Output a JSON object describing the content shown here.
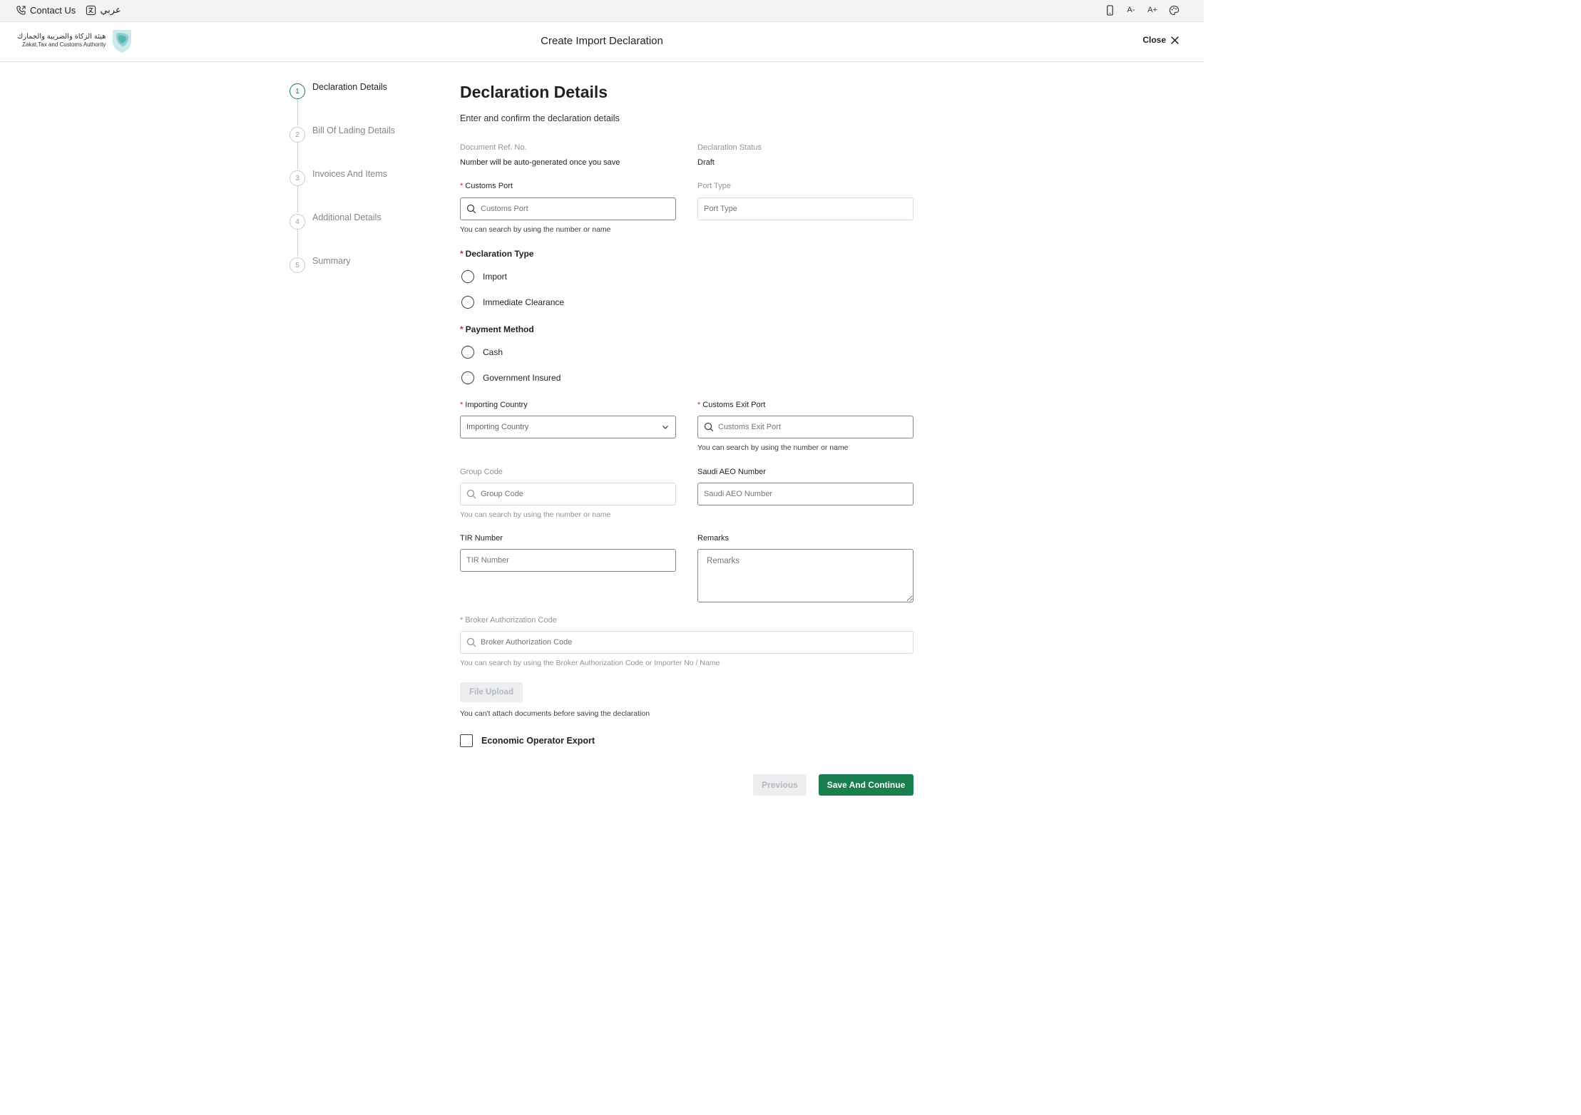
{
  "topbar": {
    "contact_label": "Contact Us",
    "language_label": "عربي",
    "icons": [
      "phone-icon",
      "translate-icon",
      "mobile-icon",
      "font-decrease-icon",
      "font-increase-icon",
      "palette-icon"
    ],
    "font_decrease_label": "A-",
    "font_increase_label": "A+"
  },
  "header": {
    "logo_ar": "هيئة الزكاة والضريبة والجمارك",
    "logo_en": "Zakat,Tax and Customs Authority",
    "title": "Create Import Declaration",
    "close_label": "Close"
  },
  "stepper": {
    "steps": [
      {
        "number": "1",
        "label": "Declaration Details",
        "active": true
      },
      {
        "number": "2",
        "label": "Bill Of Lading Details",
        "active": false
      },
      {
        "number": "3",
        "label": "Invoices And Items",
        "active": false
      },
      {
        "number": "4",
        "label": "Additional Details",
        "active": false
      },
      {
        "number": "5",
        "label": "Summary",
        "active": false
      }
    ]
  },
  "form": {
    "title": "Declaration Details",
    "subtitle": "Enter and confirm the declaration details",
    "doc_ref_label": "Document Ref. No.",
    "doc_ref_value": "Number will be auto-generated once you save",
    "status_label": "Declaration Status",
    "status_value": "Draft",
    "customs_port_label": "Customs Port",
    "customs_port_placeholder": "Customs Port",
    "customs_port_hint": "You can search by using the number or name",
    "port_type_label": "Port Type",
    "port_type_placeholder": "Port Type",
    "declaration_type_label": "Declaration Type",
    "declaration_type_options": [
      "Import",
      "Immediate Clearance"
    ],
    "payment_method_label": "Payment Method",
    "payment_method_options": [
      "Cash",
      "Government Insured"
    ],
    "importing_country_label": "Importing Country",
    "importing_country_placeholder": "Importing Country",
    "exit_port_label": "Customs Exit Port",
    "exit_port_placeholder": "Customs Exit Port",
    "exit_port_hint": "You can search by using the number or name",
    "group_code_label": "Group Code",
    "group_code_placeholder": "Group Code",
    "group_code_hint": "You can search by using the number or name",
    "aeo_label": "Saudi AEO Number",
    "aeo_placeholder": "Saudi AEO Number",
    "tir_label": "TIR Number",
    "tir_placeholder": "TIR Number",
    "remarks_label": "Remarks",
    "remarks_placeholder": "Remarks",
    "broker_label": "Broker Authorization Code",
    "broker_placeholder": "Broker Authorization Code",
    "broker_hint": "You can search by using the Broker Authorization Code or Importer No / Name",
    "file_upload_label": "File Upload",
    "file_upload_hint": "You can't attach documents before saving the declaration",
    "economic_operator_label": "Economic Operator Export"
  },
  "actions": {
    "previous_label": "Previous",
    "save_label": "Save And Continue"
  },
  "colors": {
    "accent": "#1a7f4e",
    "required": "#d0262c"
  }
}
